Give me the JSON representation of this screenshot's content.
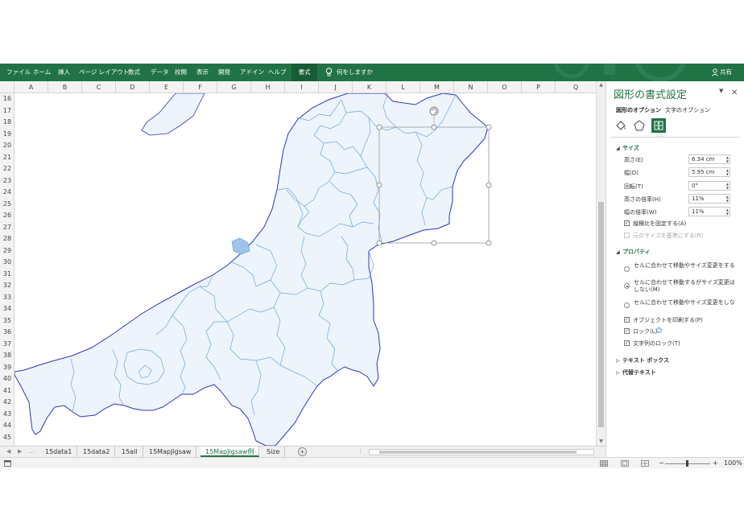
{
  "ribbon": {
    "tabs": [
      "ファイル",
      "ホーム",
      "挿入",
      "ページ レイアウト",
      "数式",
      "データ",
      "校閲",
      "表示",
      "開発",
      "アドイン",
      "ヘルプ",
      "書式"
    ],
    "active_tab": "書式",
    "tell_me": "何をしますか",
    "share": "共有",
    "color": "#217346"
  },
  "grid": {
    "columns": [
      "A",
      "B",
      "C",
      "D",
      "E",
      "F",
      "G",
      "H",
      "I",
      "J",
      "K",
      "L",
      "M",
      "N",
      "O",
      "P",
      "Q"
    ],
    "rows": [
      "16",
      "17",
      "18",
      "19",
      "20",
      "21",
      "22",
      "23",
      "24",
      "25",
      "26",
      "27",
      "28",
      "29",
      "30",
      "31",
      "32",
      "33",
      "34",
      "35",
      "36",
      "37",
      "38",
      "39",
      "40",
      "41",
      "42",
      "43",
      "44",
      "45"
    ]
  },
  "sheet_tabs": {
    "tabs": [
      "15data1",
      "15data2",
      "15all",
      "15MapJigsaw",
      "15MapJigsaw例",
      "Size"
    ],
    "active": "15MapJigsaw例"
  },
  "status": {
    "zoom": "100%"
  },
  "pane": {
    "title": "図形の書式設定",
    "tabs": [
      "図形のオプション",
      "文字のオプション"
    ],
    "icons": [
      "paint-bucket-icon",
      "pentagon-icon",
      "size-properties-icon"
    ],
    "size_section": "サイズ",
    "fields": [
      {
        "label": "高さ(E)",
        "value": "6.34 cm"
      },
      {
        "label": "幅(D)",
        "value": "5.95 cm"
      },
      {
        "label": "回転(T)",
        "value": "0°"
      },
      {
        "label": "高さの倍率(H)",
        "value": "11%"
      },
      {
        "label": "幅の倍率(W)",
        "value": "11%"
      }
    ],
    "lock_aspect": "縦横比を固定する(A)",
    "relative_original": "元のサイズを基準にする(R)",
    "properties_section": "プロパティ",
    "radios": [
      {
        "label": "セルに合わせて移動やサイズ変更をする(S)",
        "checked": false
      },
      {
        "label": "セルに合わせて移動するがサイズ変更はしない(M)",
        "checked": true
      },
      {
        "label": "セルに合わせて移動やサイズ変更をしない(D)",
        "checked": false
      }
    ],
    "print_object": "オブジェクトを印刷する(P)",
    "locked": "ロック(L)",
    "lock_text": "文字列のロック(T)",
    "textbox_section": "テキスト ボックス",
    "alt_text_section": "代替テキスト"
  }
}
